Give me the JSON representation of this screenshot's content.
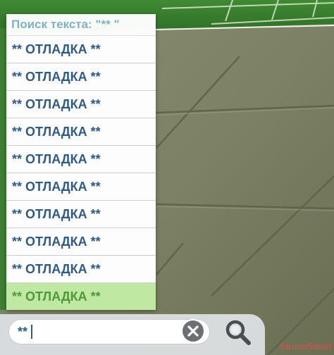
{
  "search_results": {
    "header": "Поиск текста: \"** \"",
    "items": [
      {
        "label": "** ОТЛАДКА **",
        "selected": false
      },
      {
        "label": "** ОТЛАДКА **",
        "selected": false
      },
      {
        "label": "** ОТЛАДКА **",
        "selected": false
      },
      {
        "label": "** ОТЛАДКА **",
        "selected": false
      },
      {
        "label": "** ОТЛАДКА **",
        "selected": false
      },
      {
        "label": "** ОТЛАДКА **",
        "selected": false
      },
      {
        "label": "** ОТЛАДКА **",
        "selected": false
      },
      {
        "label": "** ОТЛАДКА **",
        "selected": false
      },
      {
        "label": "** ОТЛАДКА **",
        "selected": false
      },
      {
        "label": "** ОТЛАДКА **",
        "selected": true
      }
    ]
  },
  "search_bar": {
    "value": "**",
    "clear_icon": "close-circle-icon",
    "search_icon": "magnifier-icon"
  },
  "colors": {
    "header_text": "#7fb3c4",
    "item_text": "#2f5a86",
    "selected_background": "#bfe8a3",
    "selected_text": "#4c9a3a"
  },
  "watermark": "StroimSmart"
}
